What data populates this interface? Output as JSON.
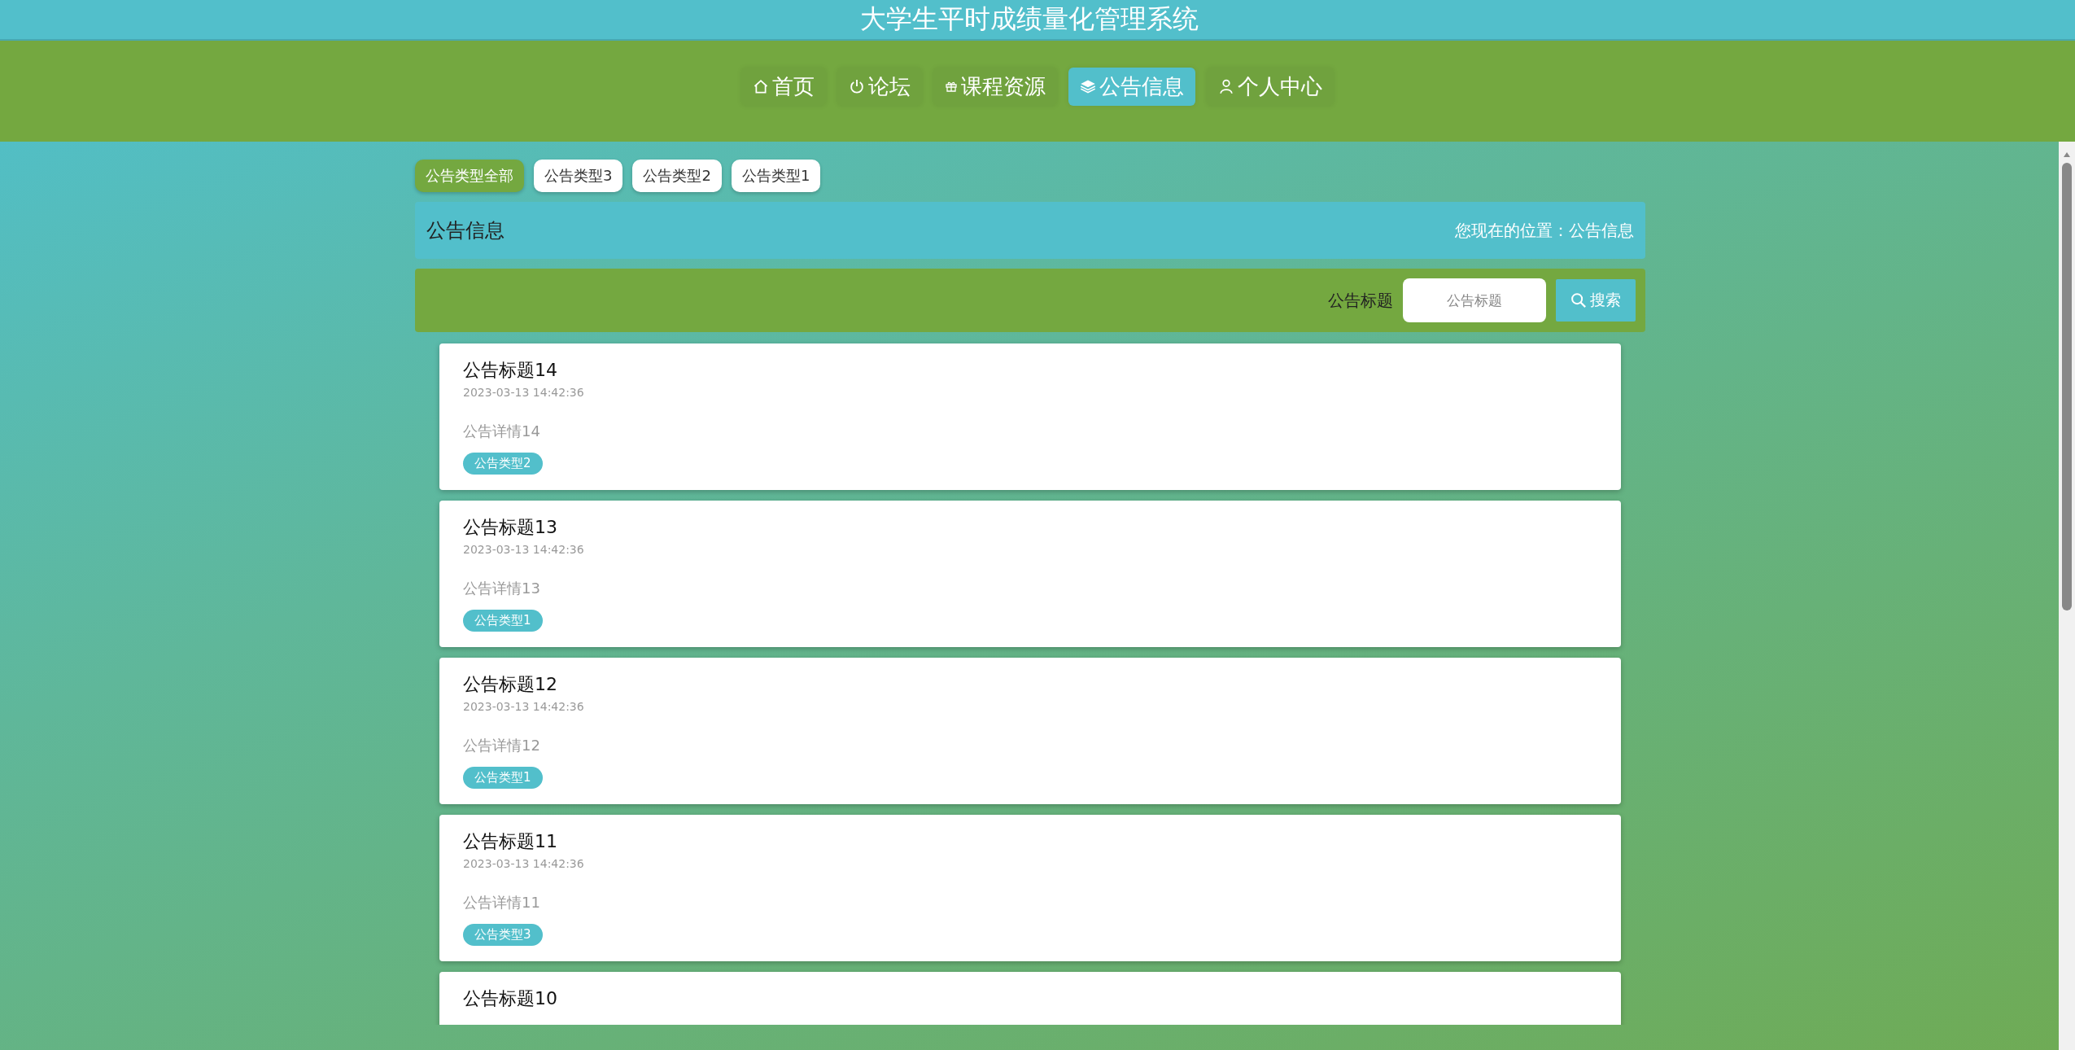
{
  "header": {
    "title": "大学生平时成绩量化管理系统"
  },
  "nav": [
    {
      "label": "首页",
      "selected": false
    },
    {
      "label": "论坛",
      "selected": false
    },
    {
      "label": "课程资源",
      "selected": false
    },
    {
      "label": "公告信息",
      "selected": true
    },
    {
      "label": "个人中心",
      "selected": false
    }
  ],
  "type_filters": [
    {
      "label": "公告类型全部",
      "selected": true
    },
    {
      "label": "公告类型3",
      "selected": false
    },
    {
      "label": "公告类型2",
      "selected": false
    },
    {
      "label": "公告类型1",
      "selected": false
    }
  ],
  "page_header": {
    "title": "公告信息",
    "breadcrumb": "您现在的位置：公告信息"
  },
  "search": {
    "label": "公告标题",
    "placeholder": "公告标题",
    "button": "搜索"
  },
  "notices": [
    {
      "title": "公告标题14",
      "time": "2023-03-13 14:42:36",
      "detail": "公告详情14",
      "tag": "公告类型2"
    },
    {
      "title": "公告标题13",
      "time": "2023-03-13 14:42:36",
      "detail": "公告详情13",
      "tag": "公告类型1"
    },
    {
      "title": "公告标题12",
      "time": "2023-03-13 14:42:36",
      "detail": "公告详情12",
      "tag": "公告类型1"
    },
    {
      "title": "公告标题11",
      "time": "2023-03-13 14:42:36",
      "detail": "公告详情11",
      "tag": "公告类型3"
    },
    {
      "title": "公告标题10"
    }
  ]
}
